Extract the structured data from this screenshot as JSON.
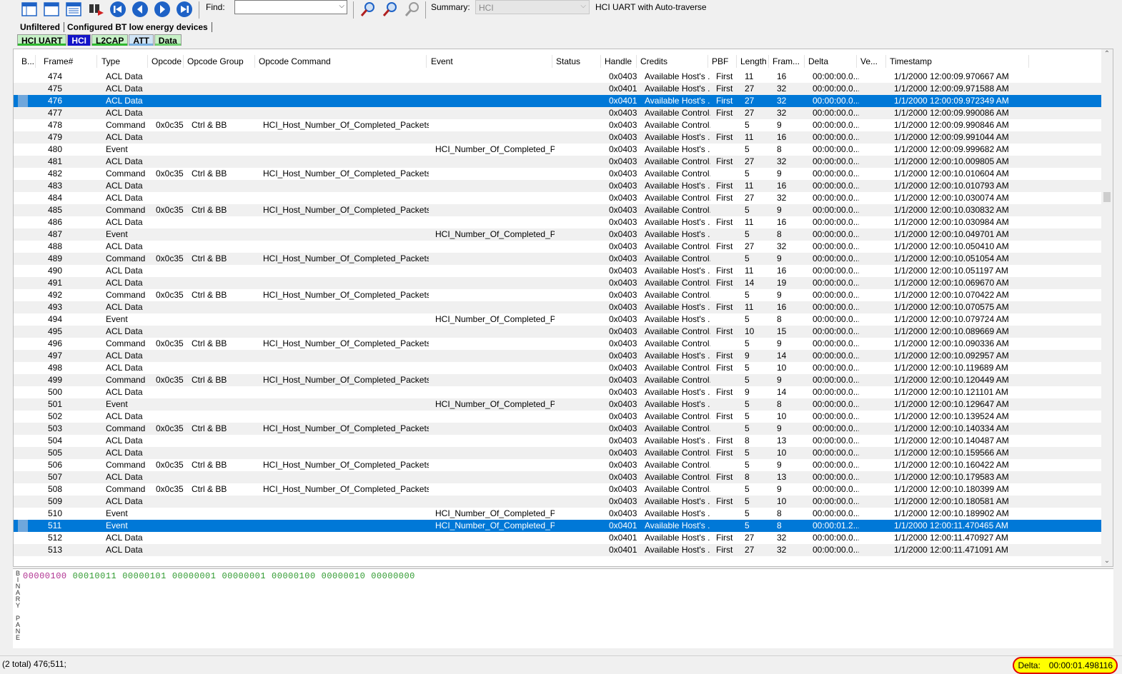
{
  "toolbar": {
    "find_label": "Find:",
    "find_value": "",
    "summary_label": "Summary:",
    "summary_value": "HCI",
    "summary_text": "HCI UART with Auto-traverse",
    "colors": {
      "nav_blue": "#1e62c6",
      "icon_grey": "#7a8a99"
    }
  },
  "filters": {
    "items": [
      "Unfiltered",
      "Configured BT low energy devices"
    ]
  },
  "protocol_tabs": [
    {
      "label": "HCI UART",
      "bg": "#c6f0c6",
      "bar": "#2fb82f"
    },
    {
      "label": "HCI",
      "bg": "#1414c8",
      "bar": "#1414c8",
      "selected": true
    },
    {
      "label": "L2CAP",
      "bg": "#c6f0c6",
      "bar": "#2fb82f"
    },
    {
      "label": "ATT",
      "bg": "#cfe3f5",
      "bar": "#7ab0e0"
    },
    {
      "label": "Data",
      "bg": "#c6f0c6",
      "bar": "#70d070"
    }
  ],
  "table": {
    "columns": [
      "B...",
      "Frame#",
      "Type",
      "Opcode",
      "Opcode Group",
      "Opcode Command",
      "Event",
      "Status",
      "Handle",
      "Credits",
      "PBF",
      "Length",
      "Fram...",
      "Delta",
      "Ve...",
      "Timestamp"
    ],
    "rows": [
      [
        "",
        "474",
        "ACL Data",
        "",
        "",
        "",
        "",
        "",
        "0x0403",
        "Available Host's ...",
        "First",
        "11",
        "16",
        "00:00:00.0...",
        "",
        "1/1/2000 12:00:09.970667 AM"
      ],
      [
        "",
        "475",
        "ACL Data",
        "",
        "",
        "",
        "",
        "",
        "0x0401",
        "Available Host's ...",
        "First",
        "27",
        "32",
        "00:00:00.0...",
        "",
        "1/1/2000 12:00:09.971588 AM"
      ],
      [
        "",
        "476",
        "ACL Data",
        "",
        "",
        "",
        "",
        "",
        "0x0401",
        "Available Host's ...",
        "First",
        "27",
        "32",
        "00:00:00.0...",
        "",
        "1/1/2000 12:00:09.972349 AM"
      ],
      [
        "",
        "477",
        "ACL Data",
        "",
        "",
        "",
        "",
        "",
        "0x0403",
        "Available Control...",
        "First",
        "27",
        "32",
        "00:00:00.0...",
        "",
        "1/1/2000 12:00:09.990086 AM"
      ],
      [
        "",
        "478",
        "Command",
        "0x0c35",
        "Ctrl & BB",
        "HCI_Host_Number_Of_Completed_Packets",
        "",
        "",
        "0x0403",
        "Available Control...",
        "",
        "5",
        "9",
        "00:00:00.0...",
        "",
        "1/1/2000 12:00:09.990846 AM"
      ],
      [
        "",
        "479",
        "ACL Data",
        "",
        "",
        "",
        "",
        "",
        "0x0403",
        "Available Host's ...",
        "First",
        "11",
        "16",
        "00:00:00.0...",
        "",
        "1/1/2000 12:00:09.991044 AM"
      ],
      [
        "",
        "480",
        "Event",
        "",
        "",
        "",
        "HCI_Number_Of_Completed_Pa...",
        "",
        "0x0403",
        "Available Host's ...",
        "",
        "5",
        "8",
        "00:00:00.0...",
        "",
        "1/1/2000 12:00:09.999682 AM"
      ],
      [
        "",
        "481",
        "ACL Data",
        "",
        "",
        "",
        "",
        "",
        "0x0403",
        "Available Control...",
        "First",
        "27",
        "32",
        "00:00:00.0...",
        "",
        "1/1/2000 12:00:10.009805 AM"
      ],
      [
        "",
        "482",
        "Command",
        "0x0c35",
        "Ctrl & BB",
        "HCI_Host_Number_Of_Completed_Packets",
        "",
        "",
        "0x0403",
        "Available Control...",
        "",
        "5",
        "9",
        "00:00:00.0...",
        "",
        "1/1/2000 12:00:10.010604 AM"
      ],
      [
        "",
        "483",
        "ACL Data",
        "",
        "",
        "",
        "",
        "",
        "0x0403",
        "Available Host's ...",
        "First",
        "11",
        "16",
        "00:00:00.0...",
        "",
        "1/1/2000 12:00:10.010793 AM"
      ],
      [
        "",
        "484",
        "ACL Data",
        "",
        "",
        "",
        "",
        "",
        "0x0403",
        "Available Control...",
        "First",
        "27",
        "32",
        "00:00:00.0...",
        "",
        "1/1/2000 12:00:10.030074 AM"
      ],
      [
        "",
        "485",
        "Command",
        "0x0c35",
        "Ctrl & BB",
        "HCI_Host_Number_Of_Completed_Packets",
        "",
        "",
        "0x0403",
        "Available Control...",
        "",
        "5",
        "9",
        "00:00:00.0...",
        "",
        "1/1/2000 12:00:10.030832 AM"
      ],
      [
        "",
        "486",
        "ACL Data",
        "",
        "",
        "",
        "",
        "",
        "0x0403",
        "Available Host's ...",
        "First",
        "11",
        "16",
        "00:00:00.0...",
        "",
        "1/1/2000 12:00:10.030984 AM"
      ],
      [
        "",
        "487",
        "Event",
        "",
        "",
        "",
        "HCI_Number_Of_Completed_Pa...",
        "",
        "0x0403",
        "Available Host's ...",
        "",
        "5",
        "8",
        "00:00:00.0...",
        "",
        "1/1/2000 12:00:10.049701 AM"
      ],
      [
        "",
        "488",
        "ACL Data",
        "",
        "",
        "",
        "",
        "",
        "0x0403",
        "Available Control...",
        "First",
        "27",
        "32",
        "00:00:00.0...",
        "",
        "1/1/2000 12:00:10.050410 AM"
      ],
      [
        "",
        "489",
        "Command",
        "0x0c35",
        "Ctrl & BB",
        "HCI_Host_Number_Of_Completed_Packets",
        "",
        "",
        "0x0403",
        "Available Control...",
        "",
        "5",
        "9",
        "00:00:00.0...",
        "",
        "1/1/2000 12:00:10.051054 AM"
      ],
      [
        "",
        "490",
        "ACL Data",
        "",
        "",
        "",
        "",
        "",
        "0x0403",
        "Available Host's ...",
        "First",
        "11",
        "16",
        "00:00:00.0...",
        "",
        "1/1/2000 12:00:10.051197 AM"
      ],
      [
        "",
        "491",
        "ACL Data",
        "",
        "",
        "",
        "",
        "",
        "0x0403",
        "Available Control...",
        "First",
        "14",
        "19",
        "00:00:00.0...",
        "",
        "1/1/2000 12:00:10.069670 AM"
      ],
      [
        "",
        "492",
        "Command",
        "0x0c35",
        "Ctrl & BB",
        "HCI_Host_Number_Of_Completed_Packets",
        "",
        "",
        "0x0403",
        "Available Control...",
        "",
        "5",
        "9",
        "00:00:00.0...",
        "",
        "1/1/2000 12:00:10.070422 AM"
      ],
      [
        "",
        "493",
        "ACL Data",
        "",
        "",
        "",
        "",
        "",
        "0x0403",
        "Available Host's ...",
        "First",
        "11",
        "16",
        "00:00:00.0...",
        "",
        "1/1/2000 12:00:10.070575 AM"
      ],
      [
        "",
        "494",
        "Event",
        "",
        "",
        "",
        "HCI_Number_Of_Completed_Pa...",
        "",
        "0x0403",
        "Available Host's ...",
        "",
        "5",
        "8",
        "00:00:00.0...",
        "",
        "1/1/2000 12:00:10.079724 AM"
      ],
      [
        "",
        "495",
        "ACL Data",
        "",
        "",
        "",
        "",
        "",
        "0x0403",
        "Available Control...",
        "First",
        "10",
        "15",
        "00:00:00.0...",
        "",
        "1/1/2000 12:00:10.089669 AM"
      ],
      [
        "",
        "496",
        "Command",
        "0x0c35",
        "Ctrl & BB",
        "HCI_Host_Number_Of_Completed_Packets",
        "",
        "",
        "0x0403",
        "Available Control...",
        "",
        "5",
        "9",
        "00:00:00.0...",
        "",
        "1/1/2000 12:00:10.090336 AM"
      ],
      [
        "",
        "497",
        "ACL Data",
        "",
        "",
        "",
        "",
        "",
        "0x0403",
        "Available Host's ...",
        "First",
        "9",
        "14",
        "00:00:00.0...",
        "",
        "1/1/2000 12:00:10.092957 AM"
      ],
      [
        "",
        "498",
        "ACL Data",
        "",
        "",
        "",
        "",
        "",
        "0x0403",
        "Available Control...",
        "First",
        "5",
        "10",
        "00:00:00.0...",
        "",
        "1/1/2000 12:00:10.119689 AM"
      ],
      [
        "",
        "499",
        "Command",
        "0x0c35",
        "Ctrl & BB",
        "HCI_Host_Number_Of_Completed_Packets",
        "",
        "",
        "0x0403",
        "Available Control...",
        "",
        "5",
        "9",
        "00:00:00.0...",
        "",
        "1/1/2000 12:00:10.120449 AM"
      ],
      [
        "",
        "500",
        "ACL Data",
        "",
        "",
        "",
        "",
        "",
        "0x0403",
        "Available Host's ...",
        "First",
        "9",
        "14",
        "00:00:00.0...",
        "",
        "1/1/2000 12:00:10.121101 AM"
      ],
      [
        "",
        "501",
        "Event",
        "",
        "",
        "",
        "HCI_Number_Of_Completed_Pa...",
        "",
        "0x0403",
        "Available Host's ...",
        "",
        "5",
        "8",
        "00:00:00.0...",
        "",
        "1/1/2000 12:00:10.129647 AM"
      ],
      [
        "",
        "502",
        "ACL Data",
        "",
        "",
        "",
        "",
        "",
        "0x0403",
        "Available Control...",
        "First",
        "5",
        "10",
        "00:00:00.0...",
        "",
        "1/1/2000 12:00:10.139524 AM"
      ],
      [
        "",
        "503",
        "Command",
        "0x0c35",
        "Ctrl & BB",
        "HCI_Host_Number_Of_Completed_Packets",
        "",
        "",
        "0x0403",
        "Available Control...",
        "",
        "5",
        "9",
        "00:00:00.0...",
        "",
        "1/1/2000 12:00:10.140334 AM"
      ],
      [
        "",
        "504",
        "ACL Data",
        "",
        "",
        "",
        "",
        "",
        "0x0403",
        "Available Host's ...",
        "First",
        "8",
        "13",
        "00:00:00.0...",
        "",
        "1/1/2000 12:00:10.140487 AM"
      ],
      [
        "",
        "505",
        "ACL Data",
        "",
        "",
        "",
        "",
        "",
        "0x0403",
        "Available Control...",
        "First",
        "5",
        "10",
        "00:00:00.0...",
        "",
        "1/1/2000 12:00:10.159566 AM"
      ],
      [
        "",
        "506",
        "Command",
        "0x0c35",
        "Ctrl & BB",
        "HCI_Host_Number_Of_Completed_Packets",
        "",
        "",
        "0x0403",
        "Available Control...",
        "",
        "5",
        "9",
        "00:00:00.0...",
        "",
        "1/1/2000 12:00:10.160422 AM"
      ],
      [
        "",
        "507",
        "ACL Data",
        "",
        "",
        "",
        "",
        "",
        "0x0403",
        "Available Control...",
        "First",
        "8",
        "13",
        "00:00:00.0...",
        "",
        "1/1/2000 12:00:10.179583 AM"
      ],
      [
        "",
        "508",
        "Command",
        "0x0c35",
        "Ctrl & BB",
        "HCI_Host_Number_Of_Completed_Packets",
        "",
        "",
        "0x0403",
        "Available Control...",
        "",
        "5",
        "9",
        "00:00:00.0...",
        "",
        "1/1/2000 12:00:10.180399 AM"
      ],
      [
        "",
        "509",
        "ACL Data",
        "",
        "",
        "",
        "",
        "",
        "0x0403",
        "Available Host's ...",
        "First",
        "5",
        "10",
        "00:00:00.0...",
        "",
        "1/1/2000 12:00:10.180581 AM"
      ],
      [
        "",
        "510",
        "Event",
        "",
        "",
        "",
        "HCI_Number_Of_Completed_Pa...",
        "",
        "0x0403",
        "Available Host's ...",
        "",
        "5",
        "8",
        "00:00:00.0...",
        "",
        "1/1/2000 12:00:10.189902 AM"
      ],
      [
        "",
        "511",
        "Event",
        "",
        "",
        "",
        "HCI_Number_Of_Completed_Pa...",
        "",
        "0x0401",
        "Available Host's ...",
        "",
        "5",
        "8",
        "00:00:01.2...",
        "",
        "1/1/2000 12:00:11.470465 AM"
      ],
      [
        "",
        "512",
        "ACL Data",
        "",
        "",
        "",
        "",
        "",
        "0x0401",
        "Available Host's ...",
        "First",
        "27",
        "32",
        "00:00:00.0...",
        "",
        "1/1/2000 12:00:11.470927 AM"
      ],
      [
        "",
        "513",
        "ACL Data",
        "",
        "",
        "",
        "",
        "",
        "0x0401",
        "Available Host's ...",
        "First",
        "27",
        "32",
        "00:00:00.0...",
        "",
        "1/1/2000 12:00:11.471091 AM"
      ]
    ],
    "selected_frames": [
      "476",
      "511"
    ],
    "colors": {
      "selection": "#0078d7",
      "alt_row": "#f0f0f0"
    }
  },
  "binary_pane": {
    "label": "BINARY PANE",
    "bytes": [
      {
        "value": "00000100",
        "color": "#b03090"
      },
      {
        "value": "00010011",
        "color": "#2f9a2f"
      },
      {
        "value": "00000101",
        "color": "#2f9a2f"
      },
      {
        "value": "00000001",
        "color": "#2f9a2f"
      },
      {
        "value": "00000001",
        "color": "#2f9a2f"
      },
      {
        "value": "00000100",
        "color": "#2f9a2f"
      },
      {
        "value": "00000010",
        "color": "#2f9a2f"
      },
      {
        "value": "00000000",
        "color": "#2f9a2f"
      }
    ]
  },
  "status_bar": {
    "selection": "(2 total) 476;511;",
    "delta_label": "Delta:",
    "delta_value": "00:00:01.498116",
    "highlight_color": "#ffff00",
    "circle_color": "#e00000"
  }
}
